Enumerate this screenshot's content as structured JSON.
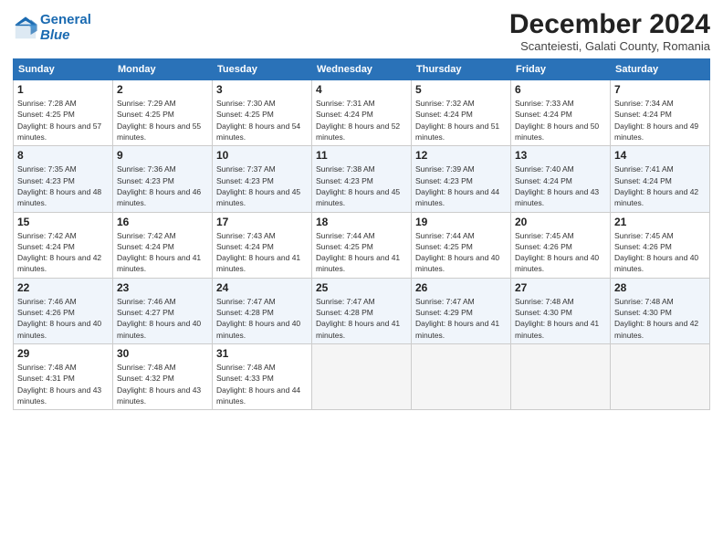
{
  "header": {
    "logo_line1": "General",
    "logo_line2": "Blue",
    "month_title": "December 2024",
    "subtitle": "Scanteiesti, Galati County, Romania"
  },
  "weekdays": [
    "Sunday",
    "Monday",
    "Tuesday",
    "Wednesday",
    "Thursday",
    "Friday",
    "Saturday"
  ],
  "weeks": [
    [
      {
        "day": "1",
        "sunrise": "Sunrise: 7:28 AM",
        "sunset": "Sunset: 4:25 PM",
        "daylight": "Daylight: 8 hours and 57 minutes."
      },
      {
        "day": "2",
        "sunrise": "Sunrise: 7:29 AM",
        "sunset": "Sunset: 4:25 PM",
        "daylight": "Daylight: 8 hours and 55 minutes."
      },
      {
        "day": "3",
        "sunrise": "Sunrise: 7:30 AM",
        "sunset": "Sunset: 4:25 PM",
        "daylight": "Daylight: 8 hours and 54 minutes."
      },
      {
        "day": "4",
        "sunrise": "Sunrise: 7:31 AM",
        "sunset": "Sunset: 4:24 PM",
        "daylight": "Daylight: 8 hours and 52 minutes."
      },
      {
        "day": "5",
        "sunrise": "Sunrise: 7:32 AM",
        "sunset": "Sunset: 4:24 PM",
        "daylight": "Daylight: 8 hours and 51 minutes."
      },
      {
        "day": "6",
        "sunrise": "Sunrise: 7:33 AM",
        "sunset": "Sunset: 4:24 PM",
        "daylight": "Daylight: 8 hours and 50 minutes."
      },
      {
        "day": "7",
        "sunrise": "Sunrise: 7:34 AM",
        "sunset": "Sunset: 4:24 PM",
        "daylight": "Daylight: 8 hours and 49 minutes."
      }
    ],
    [
      {
        "day": "8",
        "sunrise": "Sunrise: 7:35 AM",
        "sunset": "Sunset: 4:23 PM",
        "daylight": "Daylight: 8 hours and 48 minutes."
      },
      {
        "day": "9",
        "sunrise": "Sunrise: 7:36 AM",
        "sunset": "Sunset: 4:23 PM",
        "daylight": "Daylight: 8 hours and 46 minutes."
      },
      {
        "day": "10",
        "sunrise": "Sunrise: 7:37 AM",
        "sunset": "Sunset: 4:23 PM",
        "daylight": "Daylight: 8 hours and 45 minutes."
      },
      {
        "day": "11",
        "sunrise": "Sunrise: 7:38 AM",
        "sunset": "Sunset: 4:23 PM",
        "daylight": "Daylight: 8 hours and 45 minutes."
      },
      {
        "day": "12",
        "sunrise": "Sunrise: 7:39 AM",
        "sunset": "Sunset: 4:23 PM",
        "daylight": "Daylight: 8 hours and 44 minutes."
      },
      {
        "day": "13",
        "sunrise": "Sunrise: 7:40 AM",
        "sunset": "Sunset: 4:24 PM",
        "daylight": "Daylight: 8 hours and 43 minutes."
      },
      {
        "day": "14",
        "sunrise": "Sunrise: 7:41 AM",
        "sunset": "Sunset: 4:24 PM",
        "daylight": "Daylight: 8 hours and 42 minutes."
      }
    ],
    [
      {
        "day": "15",
        "sunrise": "Sunrise: 7:42 AM",
        "sunset": "Sunset: 4:24 PM",
        "daylight": "Daylight: 8 hours and 42 minutes."
      },
      {
        "day": "16",
        "sunrise": "Sunrise: 7:42 AM",
        "sunset": "Sunset: 4:24 PM",
        "daylight": "Daylight: 8 hours and 41 minutes."
      },
      {
        "day": "17",
        "sunrise": "Sunrise: 7:43 AM",
        "sunset": "Sunset: 4:24 PM",
        "daylight": "Daylight: 8 hours and 41 minutes."
      },
      {
        "day": "18",
        "sunrise": "Sunrise: 7:44 AM",
        "sunset": "Sunset: 4:25 PM",
        "daylight": "Daylight: 8 hours and 41 minutes."
      },
      {
        "day": "19",
        "sunrise": "Sunrise: 7:44 AM",
        "sunset": "Sunset: 4:25 PM",
        "daylight": "Daylight: 8 hours and 40 minutes."
      },
      {
        "day": "20",
        "sunrise": "Sunrise: 7:45 AM",
        "sunset": "Sunset: 4:26 PM",
        "daylight": "Daylight: 8 hours and 40 minutes."
      },
      {
        "day": "21",
        "sunrise": "Sunrise: 7:45 AM",
        "sunset": "Sunset: 4:26 PM",
        "daylight": "Daylight: 8 hours and 40 minutes."
      }
    ],
    [
      {
        "day": "22",
        "sunrise": "Sunrise: 7:46 AM",
        "sunset": "Sunset: 4:26 PM",
        "daylight": "Daylight: 8 hours and 40 minutes."
      },
      {
        "day": "23",
        "sunrise": "Sunrise: 7:46 AM",
        "sunset": "Sunset: 4:27 PM",
        "daylight": "Daylight: 8 hours and 40 minutes."
      },
      {
        "day": "24",
        "sunrise": "Sunrise: 7:47 AM",
        "sunset": "Sunset: 4:28 PM",
        "daylight": "Daylight: 8 hours and 40 minutes."
      },
      {
        "day": "25",
        "sunrise": "Sunrise: 7:47 AM",
        "sunset": "Sunset: 4:28 PM",
        "daylight": "Daylight: 8 hours and 41 minutes."
      },
      {
        "day": "26",
        "sunrise": "Sunrise: 7:47 AM",
        "sunset": "Sunset: 4:29 PM",
        "daylight": "Daylight: 8 hours and 41 minutes."
      },
      {
        "day": "27",
        "sunrise": "Sunrise: 7:48 AM",
        "sunset": "Sunset: 4:30 PM",
        "daylight": "Daylight: 8 hours and 41 minutes."
      },
      {
        "day": "28",
        "sunrise": "Sunrise: 7:48 AM",
        "sunset": "Sunset: 4:30 PM",
        "daylight": "Daylight: 8 hours and 42 minutes."
      }
    ],
    [
      {
        "day": "29",
        "sunrise": "Sunrise: 7:48 AM",
        "sunset": "Sunset: 4:31 PM",
        "daylight": "Daylight: 8 hours and 43 minutes."
      },
      {
        "day": "30",
        "sunrise": "Sunrise: 7:48 AM",
        "sunset": "Sunset: 4:32 PM",
        "daylight": "Daylight: 8 hours and 43 minutes."
      },
      {
        "day": "31",
        "sunrise": "Sunrise: 7:48 AM",
        "sunset": "Sunset: 4:33 PM",
        "daylight": "Daylight: 8 hours and 44 minutes."
      },
      null,
      null,
      null,
      null
    ]
  ]
}
